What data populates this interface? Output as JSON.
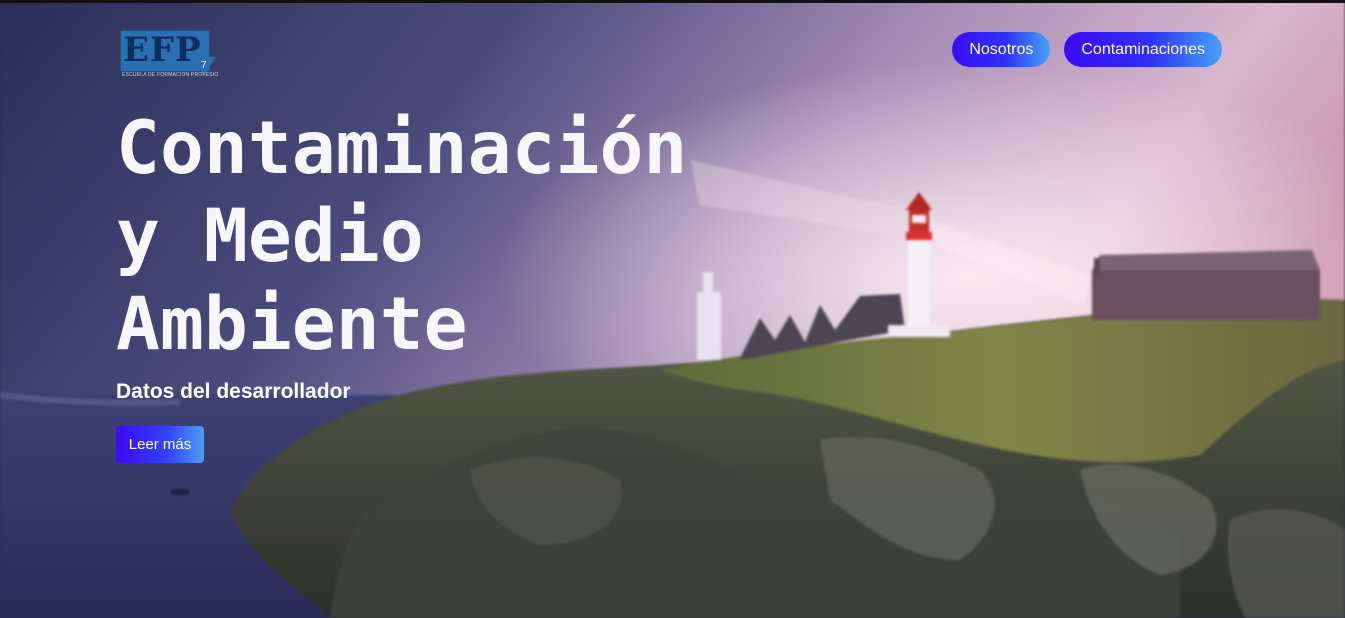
{
  "brand": {
    "logo_text": "EFP",
    "logo_number": "7",
    "logo_subtext": "ESCUELA DE FORMACIÓN PROFESIONAL"
  },
  "nav": {
    "items": [
      {
        "label": "Nosotros"
      },
      {
        "label": "Contaminaciones"
      }
    ]
  },
  "hero": {
    "title_line1": "Contaminación",
    "title_line2": "y Medio",
    "title_line3": "Ambiente",
    "subtitle": "Datos del desarrollador",
    "cta_label": "Leer más"
  },
  "colors": {
    "button_gradient_start": "#3b0bf5",
    "button_gradient_end": "#43a4f3",
    "title_color": "#f7f6fb"
  }
}
